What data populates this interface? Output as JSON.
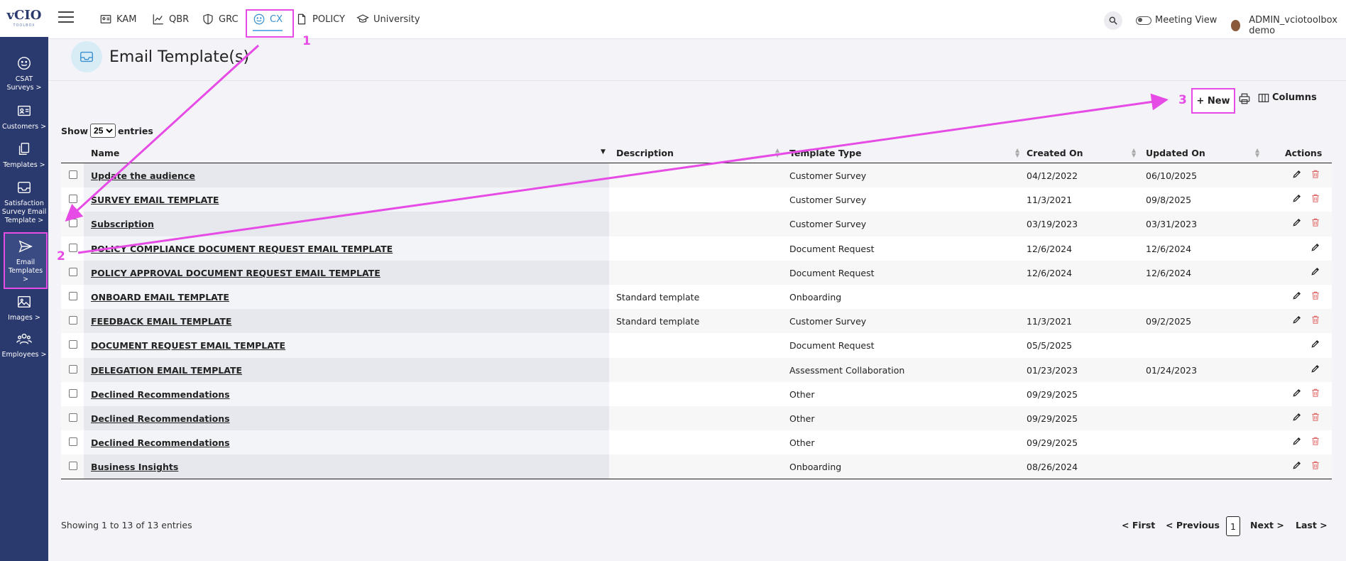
{
  "sidebar": {
    "logo_text": "vCIO",
    "logo_sub": "TOOLBOX",
    "items": [
      {
        "label": "CSAT Surveys >"
      },
      {
        "label": "Customers >"
      },
      {
        "label": "Templates >"
      },
      {
        "label": "Satisfaction Survey Email Template >"
      },
      {
        "label": "Email Templates >"
      },
      {
        "label": "Images >"
      },
      {
        "label": "Employees >"
      }
    ]
  },
  "topnav": {
    "tabs": [
      {
        "label": "KAM"
      },
      {
        "label": "QBR"
      },
      {
        "label": "GRC"
      },
      {
        "label": "CX"
      },
      {
        "label": "POLICY"
      },
      {
        "label": "University"
      }
    ],
    "search_label": "Q...",
    "meeting_view": "Meeting View",
    "user_name": "ADMIN_vciotoolbox demo"
  },
  "page": {
    "title": "Email Template(s)",
    "new_label": "+ New",
    "columns_label": "Columns",
    "show_label": "Show",
    "entries_label": "entries",
    "page_size": "25"
  },
  "table": {
    "columns": [
      "Name",
      "Description",
      "Template Type",
      "Created On",
      "Updated On",
      "Actions"
    ],
    "rows": [
      {
        "name": "Update the audience",
        "description": "",
        "type": "Customer Survey",
        "created": "04/12/2022",
        "updated": "06/10/2025",
        "deletable": true
      },
      {
        "name": "SURVEY EMAIL TEMPLATE",
        "description": "",
        "type": "Customer Survey",
        "created": "11/3/2021",
        "updated": "09/8/2025",
        "deletable": true
      },
      {
        "name": "Subscription",
        "description": "",
        "type": "Customer Survey",
        "created": "03/19/2023",
        "updated": "03/31/2023",
        "deletable": true
      },
      {
        "name": "POLICY COMPLIANCE DOCUMENT REQUEST EMAIL TEMPLATE",
        "description": "",
        "type": "Document Request",
        "created": "12/6/2024",
        "updated": "12/6/2024",
        "deletable": false
      },
      {
        "name": "POLICY APPROVAL DOCUMENT REQUEST EMAIL TEMPLATE",
        "description": "",
        "type": "Document Request",
        "created": "12/6/2024",
        "updated": "12/6/2024",
        "deletable": false
      },
      {
        "name": "ONBOARD EMAIL TEMPLATE",
        "description": "Standard template",
        "type": "Onboarding",
        "created": "",
        "updated": "",
        "deletable": true
      },
      {
        "name": "FEEDBACK EMAIL TEMPLATE",
        "description": "Standard template",
        "type": "Customer Survey",
        "created": "11/3/2021",
        "updated": "09/2/2025",
        "deletable": true
      },
      {
        "name": "DOCUMENT REQUEST EMAIL TEMPLATE",
        "description": "",
        "type": "Document Request",
        "created": "05/5/2025",
        "updated": "",
        "deletable": false
      },
      {
        "name": "DELEGATION EMAIL TEMPLATE",
        "description": "",
        "type": "Assessment Collaboration",
        "created": "01/23/2023",
        "updated": "01/24/2023",
        "deletable": false
      },
      {
        "name": "Declined Recommendations",
        "description": "",
        "type": "Other",
        "created": "09/29/2025",
        "updated": "",
        "deletable": true
      },
      {
        "name": "Declined Recommendations",
        "description": "",
        "type": "Other",
        "created": "09/29/2025",
        "updated": "",
        "deletable": true
      },
      {
        "name": "Declined Recommendations",
        "description": "",
        "type": "Other",
        "created": "09/29/2025",
        "updated": "",
        "deletable": true
      },
      {
        "name": "Business Insights",
        "description": "",
        "type": "Onboarding",
        "created": "08/26/2024",
        "updated": "",
        "deletable": true
      }
    ]
  },
  "footer": {
    "showing": "Showing 1 to 13 of 13 entries",
    "first": "< First",
    "previous": "< Previous",
    "page": "1",
    "next": "Next >",
    "last": "Last >"
  },
  "annotations": {
    "marker_1": "1",
    "marker_2": "2",
    "marker_3": "3",
    "color": "#e64be6"
  }
}
